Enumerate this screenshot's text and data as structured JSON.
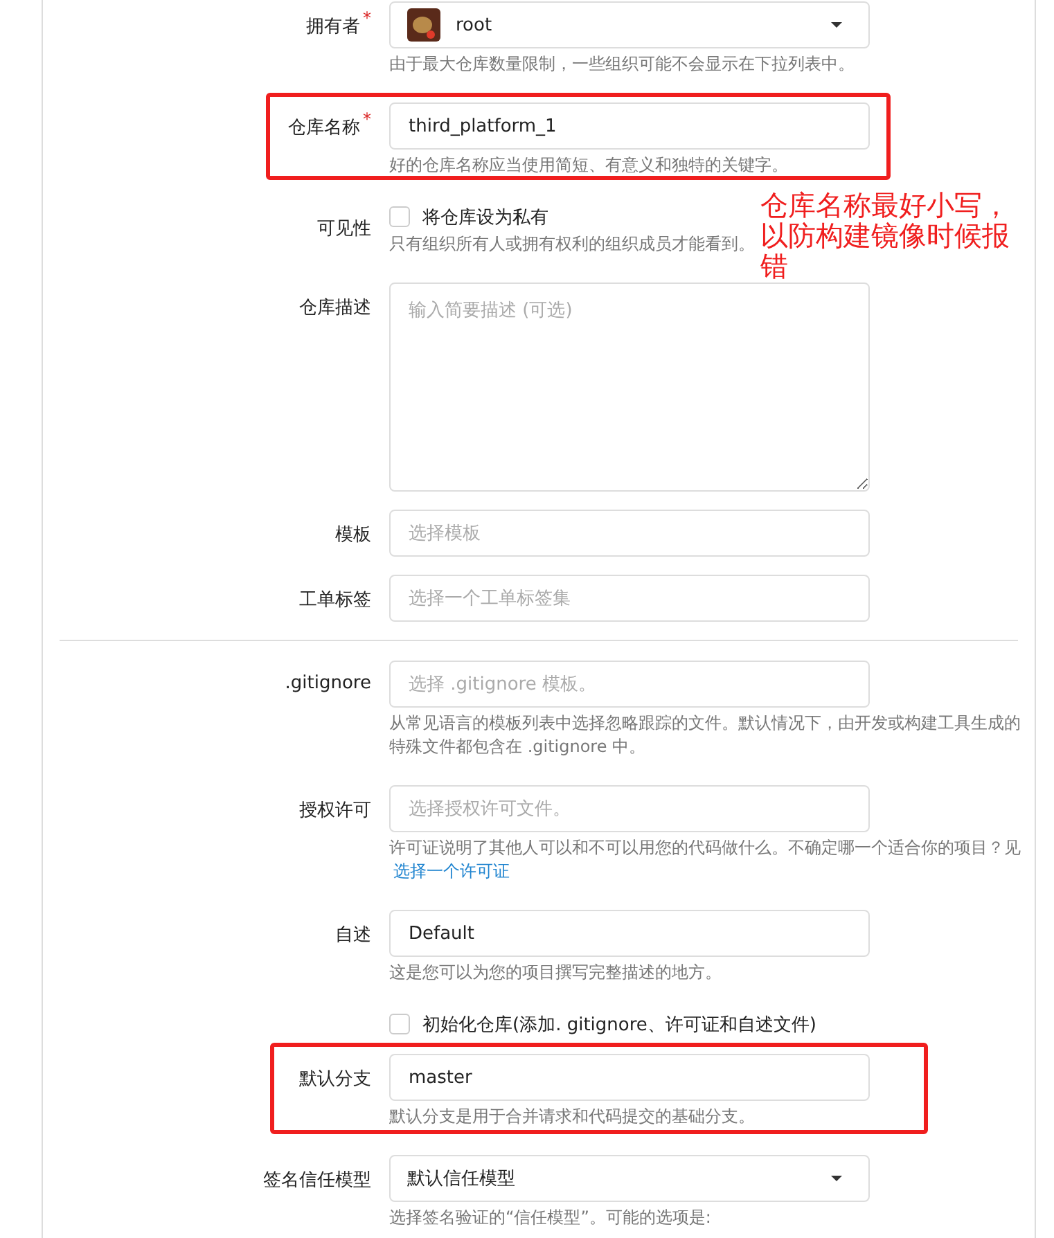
{
  "form": {
    "rows": [
      {
        "kind": "select",
        "label": "拥有者",
        "required": "*",
        "value": "root",
        "avatar": true,
        "caret": true,
        "help": "由于最大仓库数量限制，一些组织可能不会显示在下拉列表中。"
      },
      {
        "kind": "input",
        "label": "仓库名称",
        "required": "*",
        "value": "third_platform_1",
        "help": "好的仓库名称应当使用简短、有意义和独特的关键字。",
        "highlighted": true
      },
      {
        "kind": "checkbox",
        "label": "可见性",
        "text": "将仓库设为私有",
        "checked": false,
        "help": "只有组织所有人或拥有权利的组织成员才能看到。"
      },
      {
        "kind": "textarea",
        "label": "仓库描述",
        "placeholder": "输入简要描述 (可选)"
      },
      {
        "kind": "input",
        "label": "模板",
        "placeholder": "选择模板"
      },
      {
        "kind": "input",
        "label": "工单标签",
        "placeholder": "选择一个工单标签集"
      },
      {
        "kind": "divider"
      },
      {
        "kind": "input",
        "label": ".gitignore",
        "placeholder": "选择 .gitignore 模板。",
        "help": "从常见语言的模板列表中选择忽略跟踪的文件。默认情况下，由开发或构建工具生成的特殊文件都包含在 .gitignore 中。"
      },
      {
        "kind": "input",
        "label": "授权许可",
        "placeholder": "选择授权许可文件。",
        "help": "许可证说明了其他人可以和不可以用您的代码做什么。不确定哪一个适合你的项目？见",
        "help_link": "选择一个许可证"
      },
      {
        "kind": "input",
        "label": "自述",
        "value": "Default",
        "help": "这是您可以为您的项目撰写完整描述的地方。"
      },
      {
        "kind": "checkbox",
        "text": "初始化仓库(添加. gitignore、许可证和自述文件)",
        "checked": false
      },
      {
        "kind": "input",
        "label": "默认分支",
        "value": "master",
        "help": "默认分支是用于合并请求和代码提交的基础分支。",
        "highlighted": true
      },
      {
        "kind": "select",
        "label": "签名信任模型",
        "value": "默认信任模型",
        "caret": true,
        "help": "选择签名验证的“信任模型”。可能的选项是:"
      }
    ]
  },
  "annotation": {
    "text": "仓库名称最好小写，以防构建镜像时候报错"
  }
}
